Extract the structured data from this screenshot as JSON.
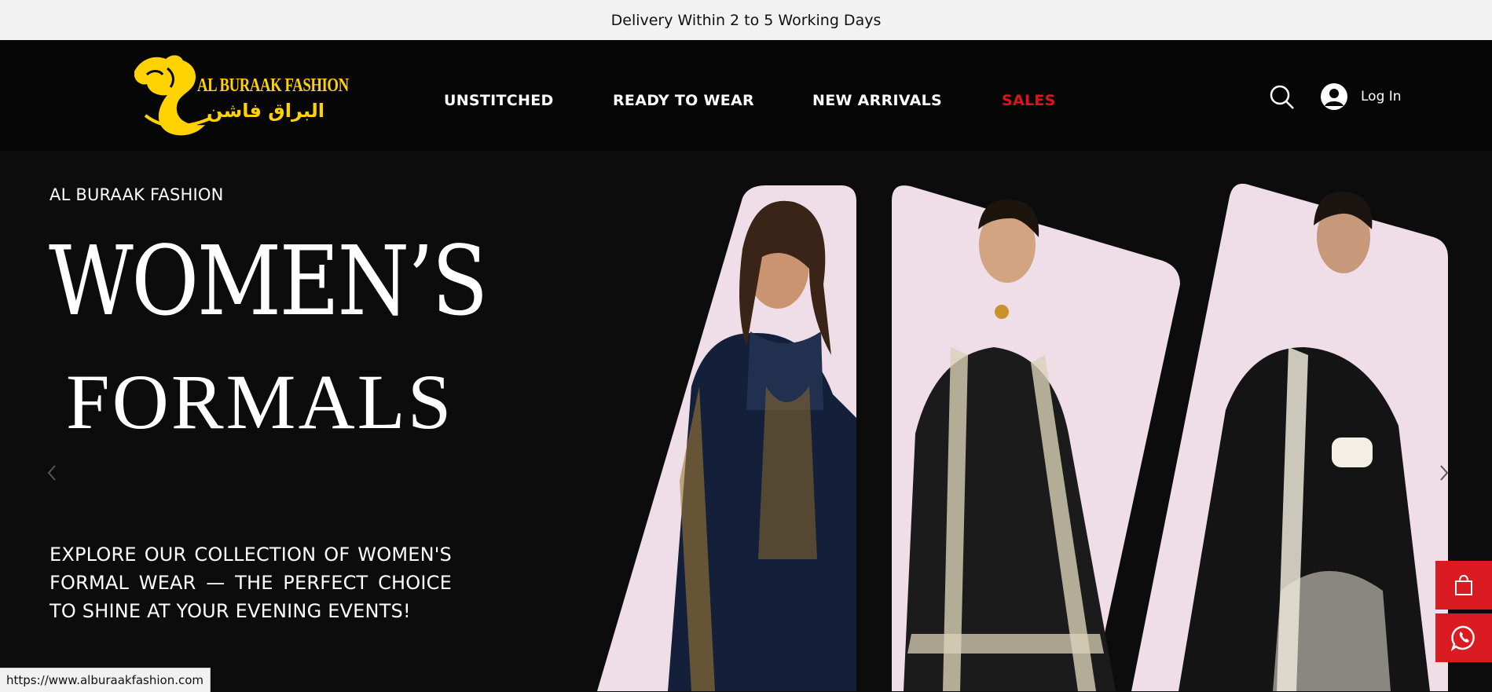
{
  "announcement": {
    "text": "Delivery Within 2 to 5 Working Days"
  },
  "logo": {
    "name_en": "AL BURAAK FASHION",
    "name_ar": "البراق فاشن",
    "gold_color": "#ffd200"
  },
  "nav": {
    "items": [
      {
        "label": "UNSTITCHED"
      },
      {
        "label": "READY TO WEAR"
      },
      {
        "label": "NEW ARRIVALS"
      },
      {
        "label": "SALES",
        "color": "#e0121c"
      }
    ]
  },
  "header_actions": {
    "search_icon": "search-icon",
    "login_label": "Log In",
    "avatar_icon": "user-avatar-icon"
  },
  "hero": {
    "brand_line": "AL BURAAK FASHION",
    "title_line1": "WOMEN’S",
    "title_line2": "FORMALS",
    "description": "EXPLORE OUR COLLECTION OF WOMEN'S FORMAL WEAR — THE PERFECT CHOICE TO SHINE AT YOUR EVENING EVENTS!",
    "prev_icon": "chevron-left-icon",
    "next_icon": "chevron-right-icon",
    "product_images": [
      "model-navy-embroidered-suit",
      "model-black-silver-embroidered-suit",
      "model-black-white-embroidered-gown"
    ]
  },
  "floating": {
    "cart_icon": "shopping-bag-icon",
    "whatsapp_icon": "whatsapp-icon",
    "accent": "#da1c22"
  },
  "status_bar": {
    "url": "https://www.alburaakfashion.com"
  }
}
